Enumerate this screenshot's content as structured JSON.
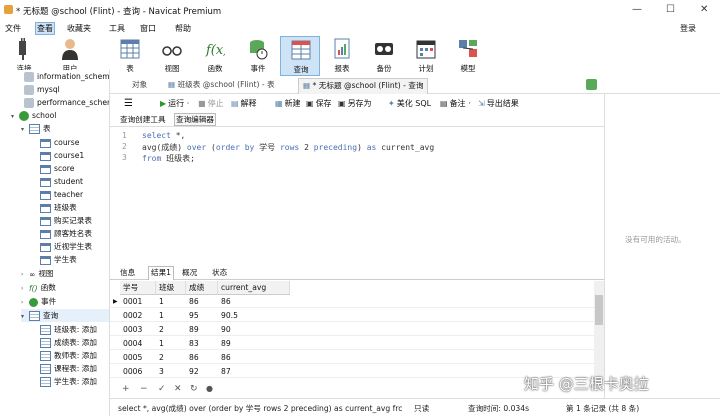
{
  "window": {
    "title": "* 无标题 @school (Flint) - 查询 - Navicat Premium"
  },
  "menu": [
    "文件",
    "查看",
    "收藏夹",
    "工具",
    "窗口",
    "帮助"
  ],
  "login_label": "登录",
  "toolbar": [
    "连接",
    "用户",
    "表",
    "视图",
    "函数",
    "事件",
    "查询",
    "报表",
    "备份",
    "计划",
    "模型"
  ],
  "sidebar": {
    "top_items": [
      "information_schema",
      "mysql",
      "performance_schema"
    ],
    "db": "school",
    "tables_group": "表",
    "tables": [
      "course",
      "course1",
      "score",
      "student",
      "teacher",
      "班级表",
      "购买记录表",
      "顾客姓名表",
      "近视学生表",
      "学生表"
    ],
    "views": "视图",
    "functions": "函数",
    "events": "事件",
    "queries_group": "查询",
    "queries": [
      "班级表: 添加",
      "成绩表: 添加",
      "教师表: 添加",
      "课程表: 添加",
      "学生表: 添加"
    ]
  },
  "tabs": [
    "对象",
    "班级表 @school (Flint) - 表",
    "* 无标题 @school (Flint) - 查询"
  ],
  "query_toolbar": {
    "run": "运行 ·",
    "stop": "停止",
    "explain": "解释",
    "new": "新建",
    "save": "保存",
    "save_as": "另存为",
    "beautify": "美化 SQL",
    "note": "备注 ·",
    "export": "导出结果"
  },
  "subtabs": [
    "查询创建工具",
    "查询编辑器"
  ],
  "editor": {
    "lines": [
      {
        "n": "1",
        "text": "select *,"
      },
      {
        "n": "2",
        "text": "avg(成绩) over (order by 学号 rows 2 preceding) as current_avg"
      },
      {
        "n": "3",
        "text": "from 班级表;"
      }
    ]
  },
  "result_tabs": [
    "信息",
    "结果1",
    "概况",
    "状态"
  ],
  "grid": {
    "columns": [
      "学号",
      "班级",
      "成绩",
      "current_avg"
    ],
    "rows": [
      [
        "0001",
        "1",
        "86",
        "86"
      ],
      [
        "0002",
        "1",
        "95",
        "90.5"
      ],
      [
        "0003",
        "2",
        "89",
        "90"
      ],
      [
        "0004",
        "1",
        "83",
        "89"
      ],
      [
        "0005",
        "2",
        "86",
        "86"
      ],
      [
        "0006",
        "3",
        "92",
        "87"
      ]
    ]
  },
  "right_panel_text": "没有可用的活动。",
  "status": {
    "sql": "select *, avg(成绩) over (order by 学号 rows 2 preceding) as current_avg  frc",
    "mode": "只读",
    "time": "查询时间: 0.034s",
    "records": "第 1 条记录 (共 8 条)"
  },
  "watermark": "知乎 @三根卡奥拉"
}
